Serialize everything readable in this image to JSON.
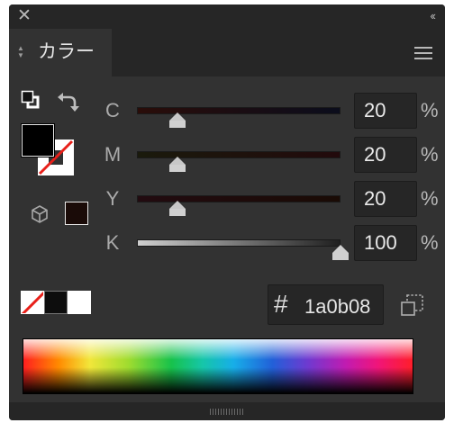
{
  "panel": {
    "close_icon": "close-icon",
    "collapse_icon": "double-chevron-left-icon",
    "tab_title": "カラー",
    "menu_icon": "hamburger-menu-icon"
  },
  "colors": {
    "panel_bg": "#323232",
    "bar_bg": "#262626",
    "current_color": "#1a0b08",
    "label": "#aaaaaa"
  },
  "sliders": [
    {
      "label": "C",
      "value": "20",
      "unit": "%",
      "level": 0.2
    },
    {
      "label": "M",
      "value": "20",
      "unit": "%",
      "level": 0.2
    },
    {
      "label": "Y",
      "value": "20",
      "unit": "%",
      "level": 0.2
    },
    {
      "label": "K",
      "value": "100",
      "unit": "%",
      "level": 1.0
    }
  ],
  "hex": {
    "hash": "#",
    "value": "1a0b08"
  },
  "icons": {
    "default_colors": "default-fill-stroke-icon",
    "swap": "swap-fill-stroke-icon",
    "out_of_gamut": "out-of-gamut-cube-icon",
    "web_safe": "web-safe-cube-icon"
  }
}
